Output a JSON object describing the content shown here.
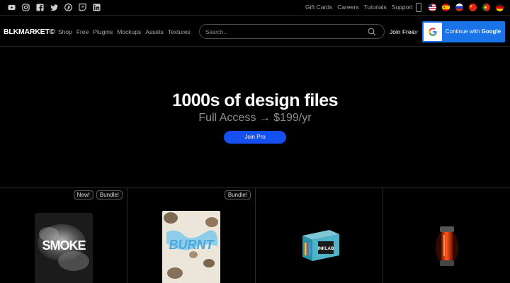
{
  "social": [
    "youtube-icon",
    "instagram-icon",
    "facebook-icon",
    "twitter-icon",
    "pinterest-icon",
    "twitch-icon",
    "linkedin-icon"
  ],
  "topbar": {
    "links": [
      "Gift Cards",
      "Careers",
      "Tutorials",
      "Support"
    ],
    "flags": [
      "flag-us-icon",
      "flag-es-icon",
      "flag-ru-icon",
      "flag-cn-icon",
      "flag-pt-icon",
      "flag-de-icon"
    ]
  },
  "nav": {
    "logo": "BLKMARKET©",
    "links": [
      "Shop",
      "Free",
      "Plugins",
      "Mockups",
      "Assets",
      "Textures"
    ],
    "search_placeholder": "Search...",
    "join_free": "Join Free",
    "or": "or",
    "google_prefix": "Continue with ",
    "google_brand": "Google"
  },
  "hero": {
    "title": "1000s of design files",
    "subtitle": "Full Access → $199/yr",
    "cta": "Join Pro"
  },
  "products": [
    {
      "badges": [
        "New!",
        "Bundle!"
      ],
      "thumb_text": "SMOKE"
    },
    {
      "badges": [
        "Bundle!"
      ],
      "thumb_text": "BURNT"
    },
    {
      "badges": [],
      "thumb_text": "INKLAB"
    },
    {
      "badges": [],
      "thumb_text": ""
    }
  ],
  "colors": {
    "accent": "#1450f0",
    "google_blue": "#1a73e8",
    "background": "#000000"
  }
}
